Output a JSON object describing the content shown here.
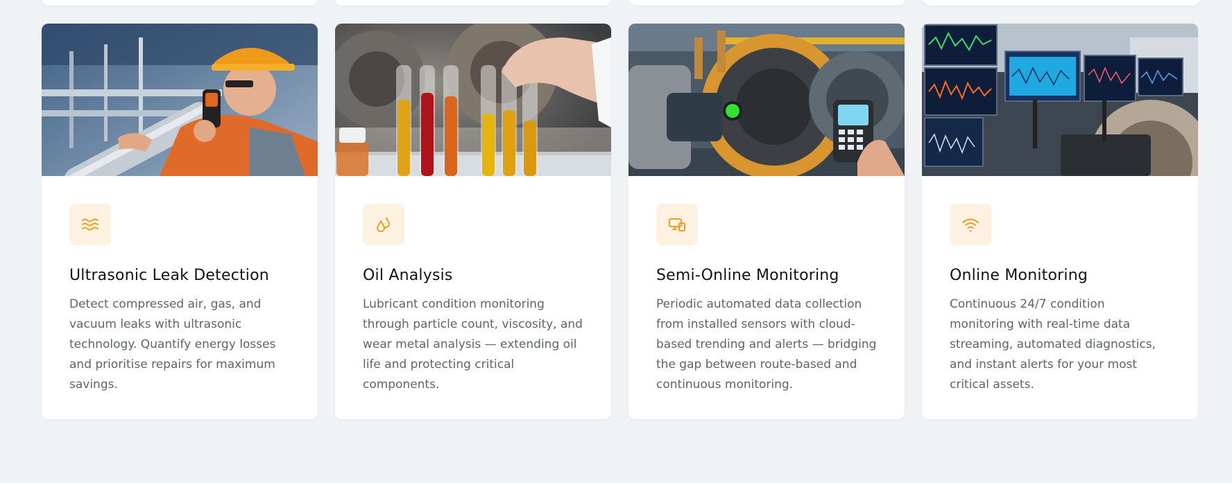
{
  "theme": {
    "background": "#f0f3f5",
    "card_background": "#ffffff",
    "accent": "#e8a020",
    "icon_background": "#fdf1e1",
    "title_color": "#111418",
    "text_color": "#5b6570"
  },
  "services": [
    {
      "icon": "sound-waves-icon",
      "image": "technician-with-ultrasonic-detector-photo",
      "title": "Ultrasonic Leak Detection",
      "description": "Detect compressed air, gas, and vacuum leaks with ultrasonic technology. Quantify energy losses and prioritise repairs for maximum savings."
    },
    {
      "icon": "droplets-icon",
      "image": "oil-sample-test-tubes-photo",
      "title": "Oil Analysis",
      "description": "Lubricant condition monitoring through particle count, viscosity, and wear metal analysis — extending oil life and protecting critical components."
    },
    {
      "icon": "devices-icon",
      "image": "handheld-data-collector-photo",
      "title": "Semi-Online Monitoring",
      "description": "Periodic automated data collection from installed sensors with cloud-based trending and alerts — bridging the gap between route-based and continuous monitoring."
    },
    {
      "icon": "wifi-icon",
      "image": "monitoring-screens-photo",
      "title": "Online Monitoring",
      "description": "Continuous 24/7 condition monitoring with real-time data streaming, automated diagnostics, and instant alerts for your most critical assets."
    }
  ]
}
